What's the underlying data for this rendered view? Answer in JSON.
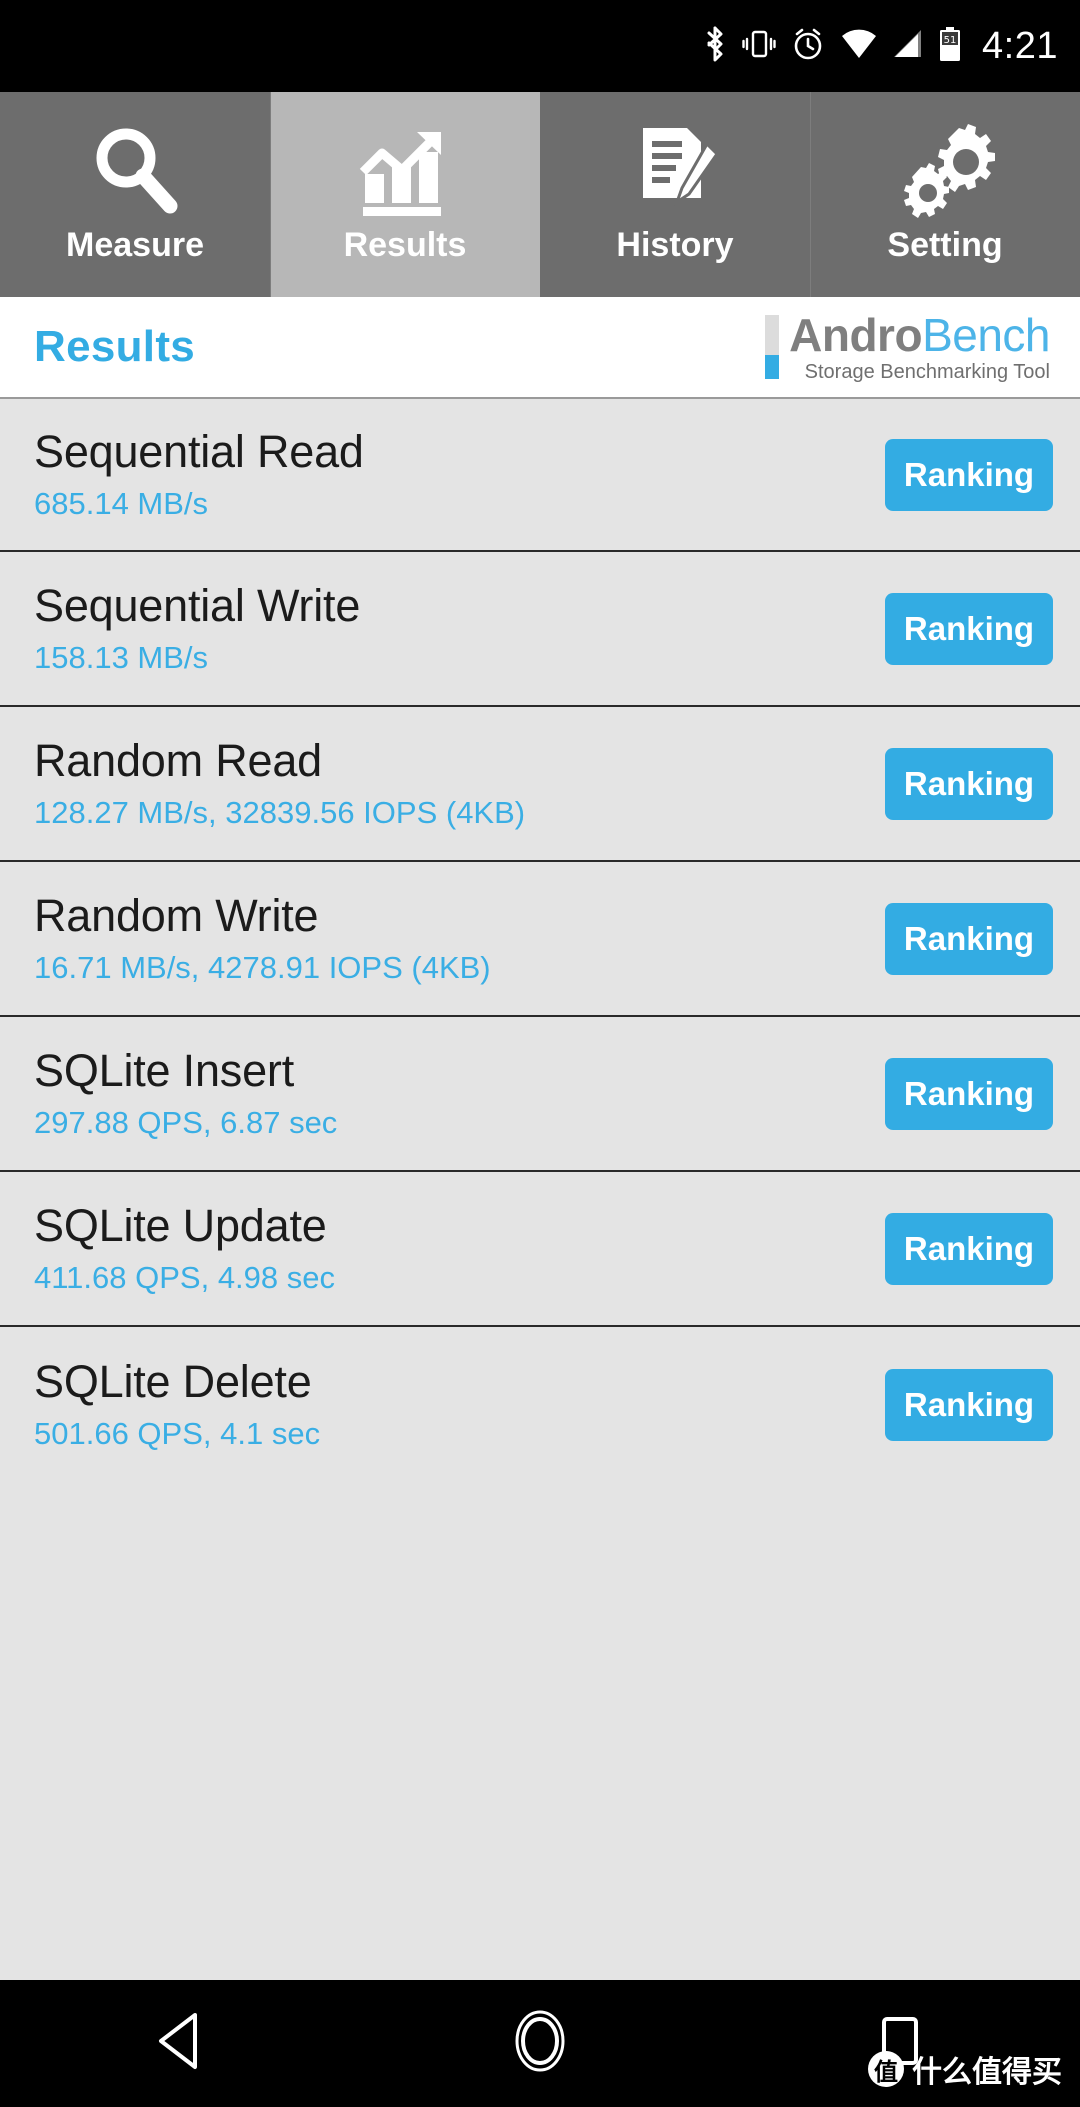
{
  "statusbar": {
    "time": "4:21",
    "icons": [
      "bluetooth-icon",
      "vibrate-icon",
      "alarm-icon",
      "wifi-icon",
      "cellular-signal-icon",
      "battery-icon"
    ],
    "battery_level": "51"
  },
  "tabs": [
    {
      "label": "Measure",
      "icon": "magnifier-icon",
      "selected": false
    },
    {
      "label": "Results",
      "icon": "bar-chart-icon",
      "selected": true
    },
    {
      "label": "History",
      "icon": "document-pen-icon",
      "selected": false
    },
    {
      "label": "Setting",
      "icon": "gears-icon",
      "selected": false
    }
  ],
  "header": {
    "title": "Results",
    "logo_primary": "Andro",
    "logo_secondary": "Bench",
    "logo_tagline": "Storage Benchmarking Tool"
  },
  "results": [
    {
      "title": "Sequential Read",
      "value": "685.14 MB/s",
      "button": "Ranking"
    },
    {
      "title": "Sequential Write",
      "value": "158.13 MB/s",
      "button": "Ranking"
    },
    {
      "title": "Random Read",
      "value": "128.27 MB/s, 32839.56 IOPS (4KB)",
      "button": "Ranking"
    },
    {
      "title": "Random Write",
      "value": "16.71 MB/s, 4278.91 IOPS (4KB)",
      "button": "Ranking"
    },
    {
      "title": "SQLite Insert",
      "value": "297.88 QPS, 6.87 sec",
      "button": "Ranking"
    },
    {
      "title": "SQLite Update",
      "value": "411.68 QPS, 4.98 sec",
      "button": "Ranking"
    },
    {
      "title": "SQLite Delete",
      "value": "501.66 QPS, 4.1 sec",
      "button": "Ranking"
    }
  ],
  "navbar": {
    "back": "back-triangle-icon",
    "home": "home-circle-icon",
    "recents": "recents-square-icon"
  },
  "watermark": {
    "mark": "值",
    "text": "什么值得买"
  },
  "colors": {
    "accent_blue": "#33ace3",
    "value_blue": "#3aaee4",
    "tab_bg": "#6d6d6d",
    "tab_selected_bg": "#b7b7b7",
    "list_bg": "#e4e4e4",
    "logo_gray": "#7f7f7f"
  }
}
